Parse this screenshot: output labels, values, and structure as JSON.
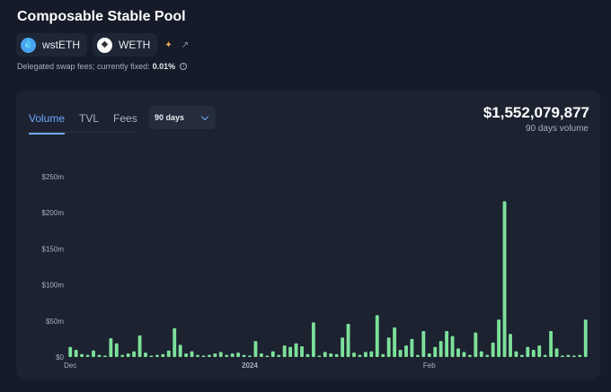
{
  "pool": {
    "title": "Composable Stable Pool",
    "tokens": [
      {
        "symbol": "wstETH",
        "icon": "wsteth-token-icon",
        "color": "#4aa3f0"
      },
      {
        "symbol": "WETH",
        "icon": "eth-token-icon",
        "color": "#ffffff"
      }
    ],
    "fee_text": "Delegated swap fees; currently fixed: ",
    "fee_value": "0.01%"
  },
  "card": {
    "tabs": [
      {
        "label": "Volume",
        "active": true
      },
      {
        "label": "TVL",
        "active": false
      },
      {
        "label": "Fees",
        "active": false
      }
    ],
    "period": "90 days",
    "total": "$1,552,079,877",
    "total_caption": "90 days volume"
  },
  "chart_data": {
    "type": "bar",
    "title": "",
    "xlabel": "",
    "ylabel": "",
    "color": "#7ce09a",
    "ylim": [
      0,
      250
    ],
    "y_unit": "million USD",
    "y_ticks": [
      "$0",
      "$50m",
      "$100m",
      "$150m",
      "$200m",
      "$250m"
    ],
    "x_ticks": [
      {
        "label": "Dec",
        "index": 0,
        "bold": false
      },
      {
        "label": "2024",
        "index": 31,
        "bold": true
      },
      {
        "label": "Feb",
        "index": 62,
        "bold": false
      }
    ],
    "values": [
      14,
      10,
      4,
      3,
      9,
      3,
      2,
      26,
      19,
      3,
      5,
      8,
      30,
      6,
      2,
      3,
      4,
      9,
      40,
      17,
      5,
      8,
      3,
      2,
      3,
      5,
      7,
      3,
      5,
      6,
      3,
      2,
      22,
      5,
      2,
      8,
      3,
      16,
      14,
      19,
      15,
      4,
      48,
      2,
      7,
      5,
      4,
      27,
      46,
      6,
      3,
      7,
      8,
      58,
      4,
      27,
      41,
      10,
      16,
      25,
      3,
      36,
      5,
      14,
      22,
      36,
      29,
      12,
      7,
      3,
      34,
      8,
      3,
      20,
      52,
      216,
      32,
      8,
      3,
      14,
      10,
      16,
      3,
      36,
      12,
      2,
      3,
      2,
      3,
      52
    ]
  }
}
